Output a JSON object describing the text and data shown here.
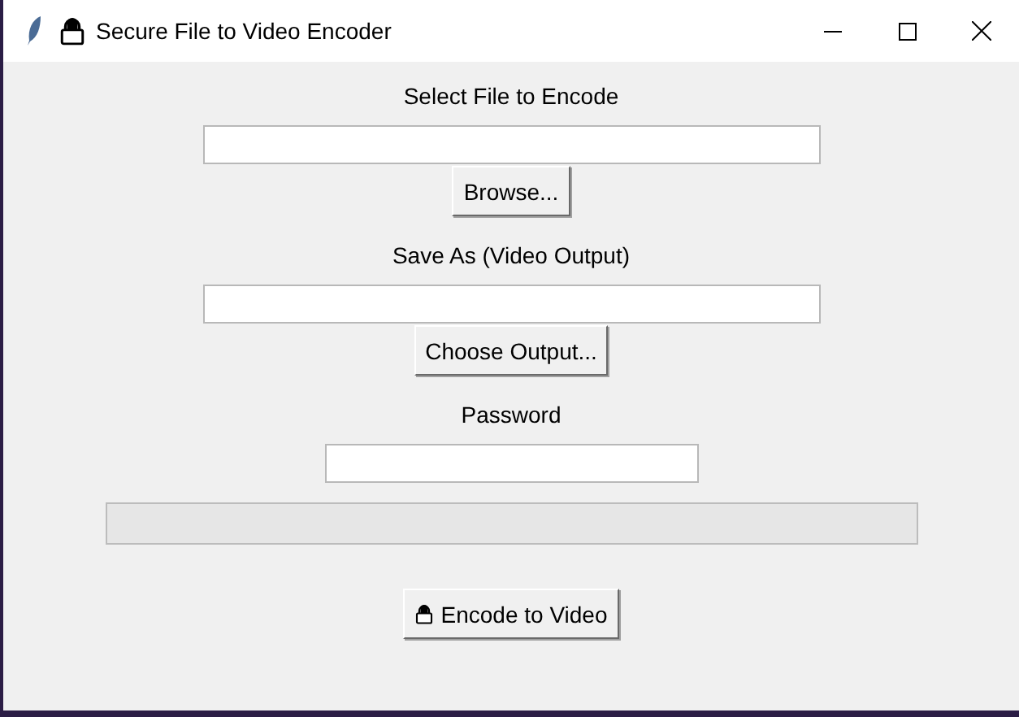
{
  "window": {
    "title": "Secure File to Video Encoder"
  },
  "fields": [
    {
      "label": "Select File to Encode",
      "button": "Browse...",
      "kind": "file"
    },
    {
      "label": "Save As (Video Output)",
      "button": "Choose Output...",
      "kind": "file"
    },
    {
      "label": "Password",
      "kind": "password"
    }
  ],
  "progress": {
    "level": 0
  },
  "action_button": "Encode to Video"
}
